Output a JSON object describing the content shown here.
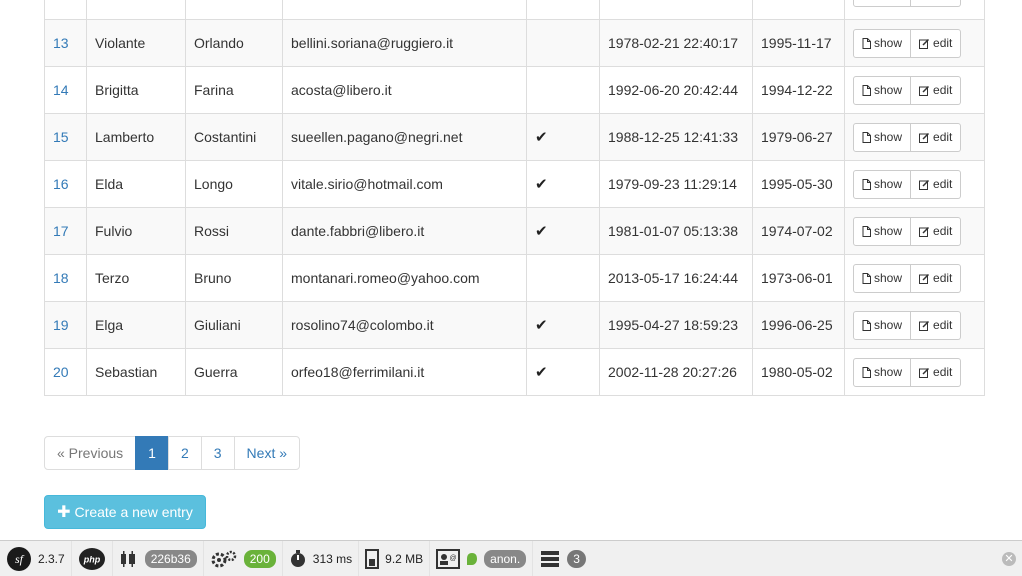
{
  "table": {
    "partial_row": {
      "id": "",
      "first": "",
      "last": "",
      "email": "",
      "checked": false,
      "created": "",
      "birth": ""
    },
    "rows": [
      {
        "id": "13",
        "first": "Violante",
        "last": "Orlando",
        "email": "bellini.soriana@ruggiero.it",
        "checked": false,
        "created": "1978-02-21 22:40:17",
        "birth": "1995-11-17"
      },
      {
        "id": "14",
        "first": "Brigitta",
        "last": "Farina",
        "email": "acosta@libero.it",
        "checked": false,
        "created": "1992-06-20 20:42:44",
        "birth": "1994-12-22"
      },
      {
        "id": "15",
        "first": "Lamberto",
        "last": "Costantini",
        "email": "sueellen.pagano@negri.net",
        "checked": true,
        "created": "1988-12-25 12:41:33",
        "birth": "1979-06-27"
      },
      {
        "id": "16",
        "first": "Elda",
        "last": "Longo",
        "email": "vitale.sirio@hotmail.com",
        "checked": true,
        "created": "1979-09-23 11:29:14",
        "birth": "1995-05-30"
      },
      {
        "id": "17",
        "first": "Fulvio",
        "last": "Rossi",
        "email": "dante.fabbri@libero.it",
        "checked": true,
        "created": "1981-01-07 05:13:38",
        "birth": "1974-07-02"
      },
      {
        "id": "18",
        "first": "Terzo",
        "last": "Bruno",
        "email": "montanari.romeo@yahoo.com",
        "checked": false,
        "created": "2013-05-17 16:24:44",
        "birth": "1973-06-01"
      },
      {
        "id": "19",
        "first": "Elga",
        "last": "Giuliani",
        "email": "rosolino74@colombo.it",
        "checked": true,
        "created": "1995-04-27 18:59:23",
        "birth": "1996-06-25"
      },
      {
        "id": "20",
        "first": "Sebastian",
        "last": "Guerra",
        "email": "orfeo18@ferrimilani.it",
        "checked": true,
        "created": "2002-11-28 20:27:26",
        "birth": "1980-05-02"
      }
    ],
    "show_label": "show",
    "edit_label": "edit",
    "check_glyph": "✔"
  },
  "pagination": {
    "previous": "« Previous",
    "pages": [
      "1",
      "2",
      "3"
    ],
    "active_page": "1",
    "next": "Next »"
  },
  "create_button": {
    "icon": "plus-icon",
    "label": "Create a new entry"
  },
  "toolbar": {
    "symfony_version": "2.3.7",
    "php_label": "php",
    "token": "226b36",
    "status_code": "200",
    "time": "313 ms",
    "memory": "9.2 MB",
    "user": "anon.",
    "db_queries": "3"
  },
  "colors": {
    "link": "#337ab7",
    "info_button": "#5bc0de",
    "status_ok": "#6ab23a"
  }
}
